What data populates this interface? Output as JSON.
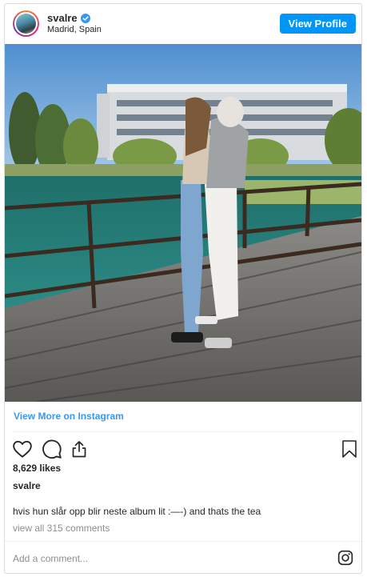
{
  "header": {
    "username": "svalre",
    "location": "Madrid, Spain",
    "verified_icon": "verified-badge-icon",
    "view_profile_label": "View Profile"
  },
  "view_more_label": "View More on Instagram",
  "actions": {
    "like_icon": "heart-icon",
    "comment_icon": "comment-bubble-icon",
    "share_icon": "share-icon",
    "save_icon": "bookmark-icon"
  },
  "likes_text": "8,629 likes",
  "post": {
    "owner": "svalre",
    "caption": "hvis hun slår opp blir neste album lit :—-) and thats the tea",
    "view_comments": "view all 315 comments"
  },
  "comment_placeholder": "Add a comment...",
  "colors": {
    "accent": "#0095f6",
    "link": "#3897f0",
    "muted": "#8e8e8e",
    "text": "#262626"
  }
}
